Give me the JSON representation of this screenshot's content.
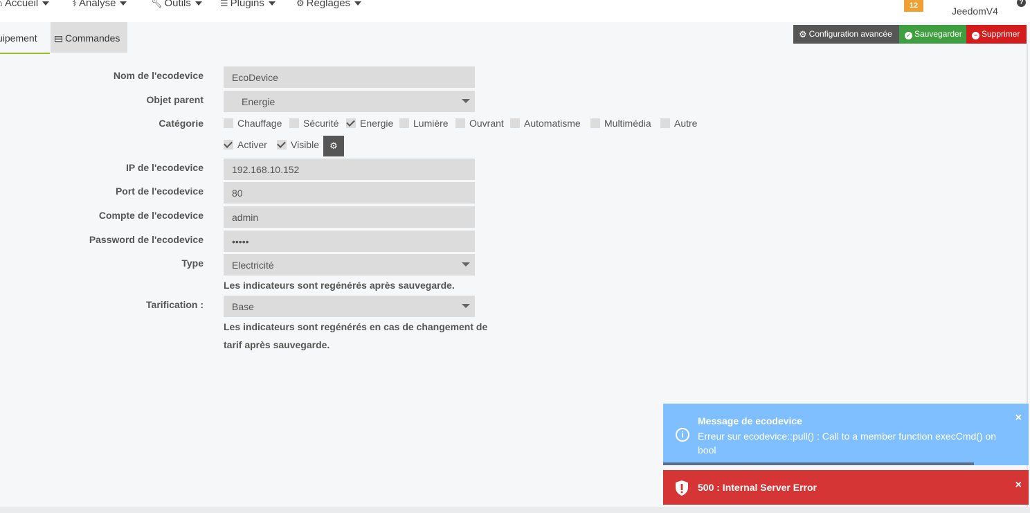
{
  "navbar": {
    "items": [
      {
        "label": "Accueil",
        "icon": "home-icon"
      },
      {
        "label": "Analyse",
        "icon": "stethoscope-icon"
      },
      {
        "label": "Outils",
        "icon": "wrench-icon"
      },
      {
        "label": "Plugins",
        "icon": "list-icon"
      },
      {
        "label": "Réglages",
        "icon": "gear-icon"
      }
    ],
    "badge": "12",
    "brand": "JeedomV4",
    "help": "?"
  },
  "tabs": [
    {
      "label": "uipement"
    },
    {
      "label": "Commandes"
    }
  ],
  "actions": {
    "config": "Configuration avancée",
    "save": "Sauvegarder",
    "delete": "Supprimer"
  },
  "form": {
    "name": {
      "label": "Nom de l'ecodevice",
      "value": "EcoDevice"
    },
    "parent": {
      "label": "Objet parent",
      "value": "Energie"
    },
    "category": {
      "label": "Catégorie",
      "options": [
        {
          "label": "Chauffage",
          "checked": false
        },
        {
          "label": "Sécurité",
          "checked": false
        },
        {
          "label": "Energie",
          "checked": true
        },
        {
          "label": "Lumière",
          "checked": false
        },
        {
          "label": "Ouvrant",
          "checked": false
        },
        {
          "label": "Automatisme",
          "checked": false
        },
        {
          "label": "Multimédia",
          "checked": false
        },
        {
          "label": "Autre",
          "checked": false
        }
      ]
    },
    "activer": {
      "label": "Activer",
      "checked": true
    },
    "visible": {
      "label": "Visible",
      "checked": true
    },
    "ip": {
      "label": "IP de l'ecodevice",
      "value": "192.168.10.152"
    },
    "port": {
      "label": "Port de l'ecodevice",
      "value": "80"
    },
    "account": {
      "label": "Compte de l'ecodevice",
      "value": "admin"
    },
    "password": {
      "label": "Password de l'ecodevice",
      "value": "•••••"
    },
    "type": {
      "label": "Type",
      "value": "Electricité",
      "help": "Les indicateurs sont regénérés après sauvegarde."
    },
    "tarif": {
      "label": "Tarification :",
      "value": "Base",
      "help_line1": "Les indicateurs sont regénérés en cas de changement de",
      "help_line2": "tarif après sauvegarde."
    }
  },
  "toasts": {
    "info": {
      "title": "Message de ecodevice",
      "message": "Erreur sur ecodevice::pull() : Call to a member function execCmd() on bool",
      "progress": 0.85
    },
    "error": {
      "message": "500 : Internal Server Error"
    },
    "close": "×"
  },
  "colors": {
    "save": "#3f9e3f",
    "delete": "#d41c1c",
    "info_toast": "#7fbfff",
    "error_toast": "#d53535",
    "badge": "#f0a030"
  }
}
